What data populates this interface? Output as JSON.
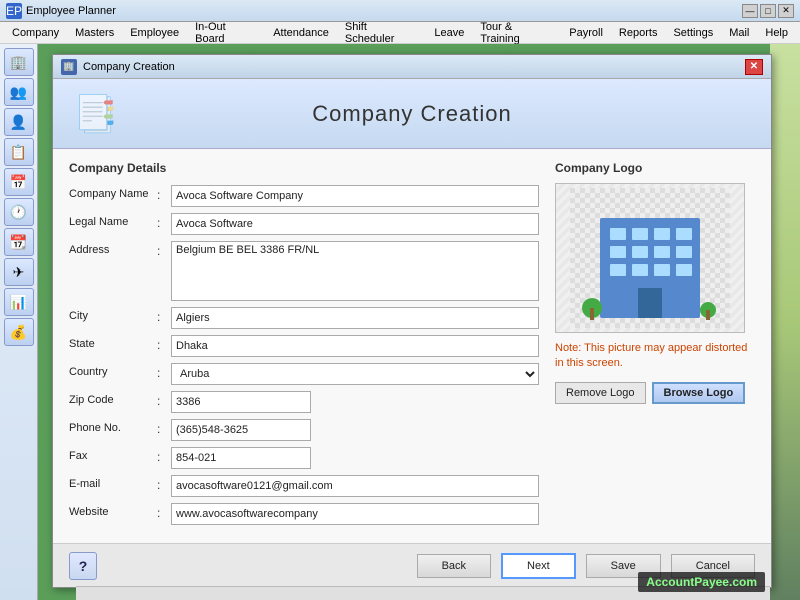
{
  "app": {
    "title": "Employee Planner",
    "icon": "EP"
  },
  "titlebar_controls": {
    "minimize": "—",
    "maximize": "□",
    "close": "✕"
  },
  "menubar": {
    "items": [
      "Company",
      "Masters",
      "Employee",
      "In-Out Board",
      "Attendance",
      "Shift Scheduler",
      "Leave",
      "Tour & Training",
      "Payroll",
      "Reports",
      "Settings",
      "Mail",
      "Help"
    ]
  },
  "sidebar": {
    "icons": [
      "🏢",
      "👥",
      "👤",
      "📋",
      "📅",
      "🕐",
      "📆",
      "✈",
      "📊",
      "💰"
    ]
  },
  "dialog": {
    "title": "Company Creation",
    "header_title": "Company Creation",
    "form": {
      "section_title": "Company Details",
      "fields": [
        {
          "label": "Company Name",
          "colon": ":",
          "value": "Avoca Software Company",
          "type": "input"
        },
        {
          "label": "Legal Name",
          "colon": ":",
          "value": "Avoca Software",
          "type": "input"
        },
        {
          "label": "Address",
          "colon": ":",
          "value": "Belgium BE BEL 3386 FR/NL",
          "type": "textarea"
        },
        {
          "label": "City",
          "colon": ":",
          "value": "Algiers",
          "type": "input"
        },
        {
          "label": "State",
          "colon": ":",
          "value": "Dhaka",
          "type": "input"
        },
        {
          "label": "Country",
          "colon": ":",
          "value": "Aruba",
          "type": "select"
        },
        {
          "label": "Zip Code",
          "colon": ":",
          "value": "3386",
          "type": "input-short"
        },
        {
          "label": "Phone No.",
          "colon": ":",
          "value": "(365)548-3625",
          "type": "input-short"
        },
        {
          "label": "Fax",
          "colon": ":",
          "value": "854-021",
          "type": "input-short"
        },
        {
          "label": "E-mail",
          "colon": ":",
          "value": "avocasoftware0121@gmail.com",
          "type": "input"
        },
        {
          "label": "Website",
          "colon": ":",
          "value": "www.avocasoftwarecompany",
          "type": "input"
        }
      ]
    },
    "logo": {
      "section_title": "Company Logo",
      "note": "Note: This picture may appear distorted in this screen.",
      "remove_label": "Remove Logo",
      "browse_label": "Browse Logo"
    },
    "footer": {
      "help_symbol": "?",
      "back_label": "Back",
      "next_label": "Next",
      "save_label": "Save",
      "cancel_label": "Cancel"
    }
  },
  "watermark": {
    "prefix": "Account",
    "highlight": "Payee",
    "suffix": ".com"
  }
}
